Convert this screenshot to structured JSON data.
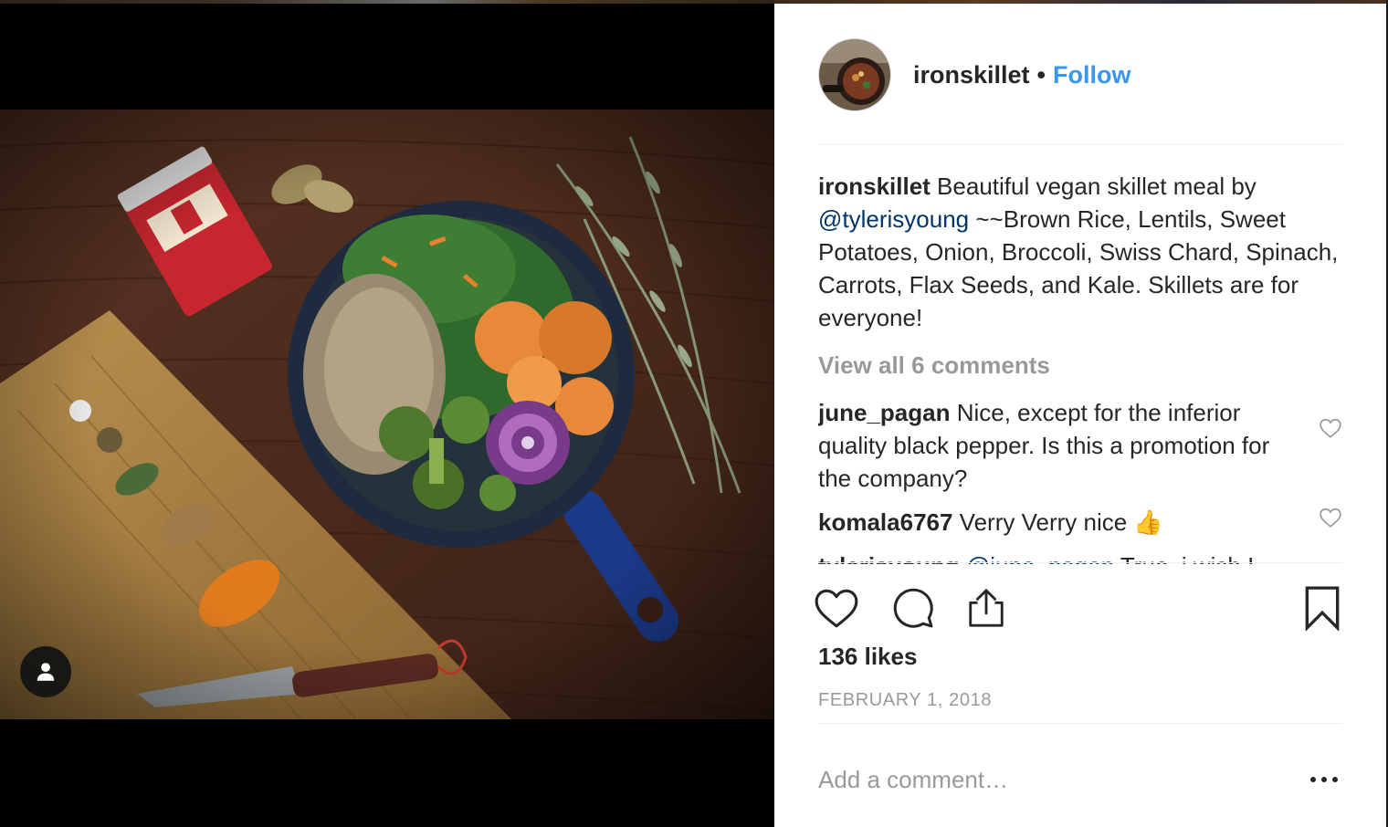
{
  "post": {
    "author": "ironskillet",
    "separator": "•",
    "follow_label": "Follow",
    "caption": {
      "author": "ironskillet",
      "text_before_mention": " Beautiful vegan skillet meal by ",
      "mention": "@tylerisyoung",
      "text_after_mention": " ~~Brown Rice, Lentils, Sweet Potatoes, Onion, Broccoli, Swiss Chard, Spinach, Carrots, Flax Seeds, and Kale. Skillets are for everyone!"
    },
    "view_all_comments": "View all 6 comments",
    "comments": [
      {
        "user": "june_pagan",
        "text": " Nice, except for the inferior quality black pepper. Is this a promotion for the company?"
      },
      {
        "user": "komala6767",
        "text": " Verry Verry nice 👍"
      },
      {
        "user": "tylerisyoung",
        "mention": " @june_pagan",
        "text": " True, i wish I"
      }
    ],
    "likes": "136 likes",
    "date": "FEBRUARY 1, 2018",
    "add_comment_placeholder": "Add a comment…"
  },
  "icons": {
    "like": "heart-icon",
    "comment": "speech-bubble-icon",
    "share": "share-icon",
    "save": "bookmark-icon",
    "more": "more-dots-icon",
    "user_tag": "person-icon"
  },
  "colors": {
    "link_blue": "#3897f0",
    "mention_blue": "#003569",
    "muted_text": "#999999",
    "primary_text": "#262626"
  }
}
